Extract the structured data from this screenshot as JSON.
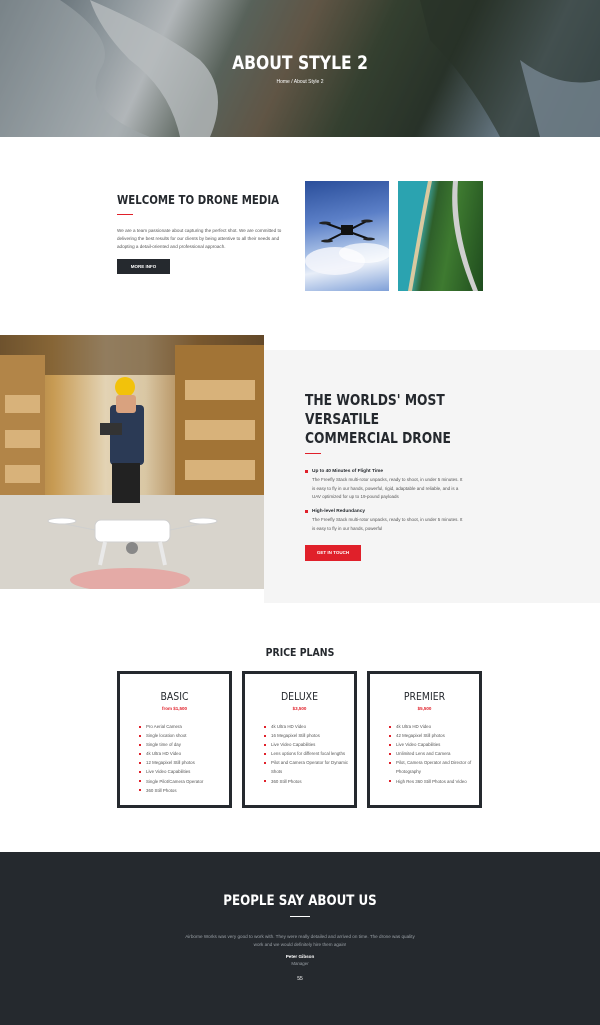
{
  "hero": {
    "title": "ABOUT STYLE 2",
    "breadcrumb": "Home / About Style 2"
  },
  "welcome": {
    "title": "WELCOME TO DRONE MEDIA",
    "text": "We are a team passionate about capturing the perfect shot. We are committed to delivering the best results for our clients by being attentive to all their needs and adopting a detail-oriented and professional approach.",
    "button": "MORE INFO"
  },
  "drone": {
    "title": "THE WORLDS' MOST VERSATILE COMMERCIAL DRONE",
    "features": [
      {
        "title": "Up to 40 Minutes of Flight Time",
        "text": "The Freefly Stack multi-rotor unpacks, ready to shoot, in under 5 minutes. It is easy to fly in our hands, powerful, rigid, adaptable and reliable, and is a UAV optimized for up to 19-pound payloads"
      },
      {
        "title": "High-level Redundancy",
        "text": "The Freefly Stack multi-rotor unpacks, ready to shoot, in under 5 minutes. It is easy to fly in our hands, powerful"
      }
    ],
    "button": "GET IN TOUCH"
  },
  "pricing": {
    "title": "PRICE PLANS",
    "plans": [
      {
        "name": "BASIC",
        "price": "from $1,500",
        "items": [
          "Pro Aerial Camera",
          "Single location shoot",
          "Single time of day",
          "4k Ultra HD Video",
          "12 Megapixel Still photos",
          "Live Video Capabilities",
          "Single Pilot/Camera Operator",
          "360 Still Photos"
        ]
      },
      {
        "name": "DELUXE",
        "price": "$3,500",
        "items": [
          "4k Ultra HD Video",
          "16 Megapixel Still photos",
          "Live Video Capabilities",
          "Lens options for different focal lengths",
          "Pilot and Camera Operator for Dynamic Shots",
          "360 Still Photos"
        ]
      },
      {
        "name": "PREMIER",
        "price": "$5,500",
        "items": [
          "4k Ultra HD Video",
          "42 Megapixel Still photos",
          "Live Video Capabilities",
          "Unlimited Lens and Camera",
          "Pilot, Camera Operator and Director of Photography",
          "High Res 360 Still Photos and Video"
        ]
      }
    ]
  },
  "testimonial": {
    "title": "PEOPLE SAY ABOUT US",
    "quote": "Airborne Works was very good to work with. They were really detailed and arrived on time. The drone was quality work and we would definitely hire them again!",
    "name": "Peter Gibson",
    "role": "Manager",
    "avatar_initials": "55"
  },
  "colors": {
    "accent": "#e0202a",
    "dark": "#25292e"
  }
}
